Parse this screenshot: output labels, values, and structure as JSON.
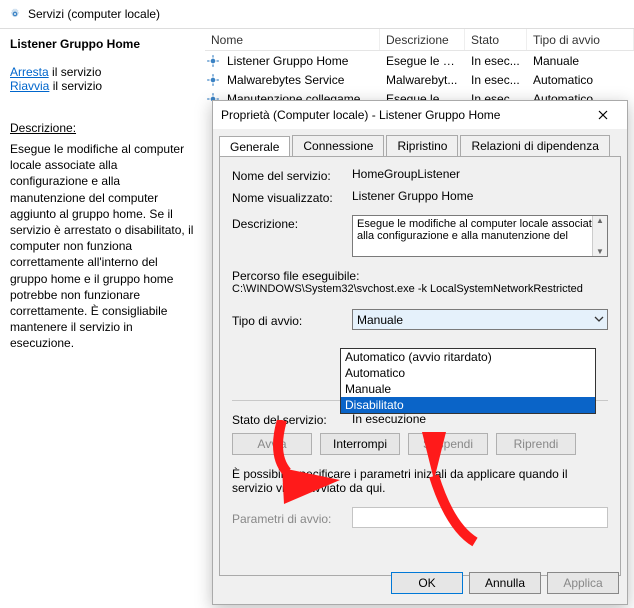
{
  "window": {
    "title": "Servizi (computer locale)"
  },
  "left": {
    "title": "Listener Gruppo Home",
    "stop_link_a": "Arresta",
    "stop_link_b": " il servizio",
    "restart_link_a": "Riavvia",
    "restart_link_b": " il servizio",
    "desc_label": "Descrizione:",
    "desc_text": "Esegue le modifiche al computer locale associate alla configurazione e alla manutenzione del computer aggiunto al gruppo home. Se il servizio è arrestato o disabilitato, il computer non funziona correttamente all'interno del gruppo home e il gruppo home potrebbe non funzionare correttamente. È consigliabile mantenere il servizio in esecuzione."
  },
  "list": {
    "headers": {
      "nome": "Nome",
      "desc": "Descrizione",
      "stato": "Stato",
      "tipo": "Tipo di avvio"
    },
    "rows": [
      {
        "nome": "Listener Gruppo Home",
        "desc": "Esegue le m...",
        "stato": "In esec...",
        "tipo": "Manuale"
      },
      {
        "nome": "Malwarebytes Service",
        "desc": "Malwarebyt...",
        "stato": "In esec...",
        "tipo": "Automatico"
      },
      {
        "nome": "Manutenzione collegament...",
        "desc": "Esegue le m...",
        "stato": "In esec...",
        "tipo": "Automatico"
      }
    ]
  },
  "dialog": {
    "title": "Proprietà (Computer locale) - Listener Gruppo Home",
    "tabs": {
      "generale": "Generale",
      "connessione": "Connessione",
      "ripristino": "Ripristino",
      "dipendenza": "Relazioni di dipendenza"
    },
    "labels": {
      "nome_serv": "Nome del servizio:",
      "nome_vis": "Nome visualizzato:",
      "descrizione": "Descrizione:",
      "percorso": "Percorso file eseguibile:",
      "tipo_avvio": "Tipo di avvio:",
      "stato_serv": "Stato del servizio:",
      "param": "Parametri di avvio:"
    },
    "values": {
      "nome_serv": "HomeGroupListener",
      "nome_vis": "Listener Gruppo Home",
      "descrizione": "Esegue le modifiche al computer locale associate alla configurazione e alla manutenzione del",
      "percorso": "C:\\WINDOWS\\System32\\svchost.exe -k LocalSystemNetworkRestricted",
      "tipo_avvio": "Manuale",
      "stato_serv": "In esecuzione",
      "param": ""
    },
    "startup_options": [
      "Automatico (avvio ritardato)",
      "Automatico",
      "Manuale",
      "Disabilitato"
    ],
    "startup_selected_index": 3,
    "buttons": {
      "avvia": "Avvia",
      "interrompi": "Interrompi",
      "sospendi": "Sospendi",
      "riprendi": "Riprendi"
    },
    "note": "È possibile specificare i parametri iniziali da applicare quando il servizio viene avviato da qui.",
    "dlg_buttons": {
      "ok": "OK",
      "annulla": "Annulla",
      "applica": "Applica"
    }
  }
}
